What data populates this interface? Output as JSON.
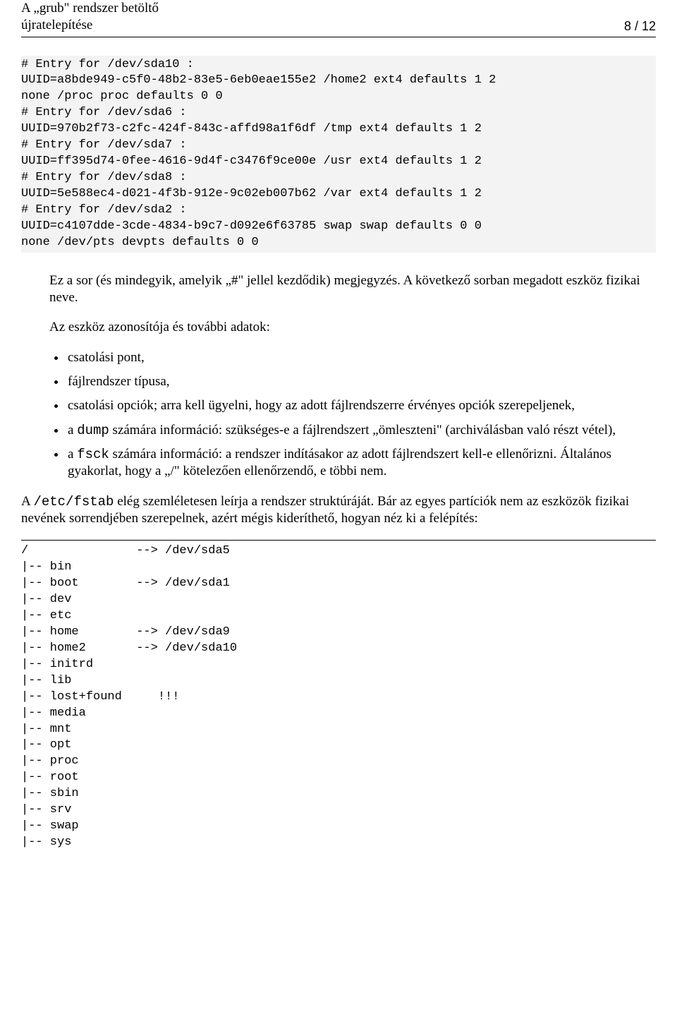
{
  "header": {
    "title_line1": "A „grub\" rendszer betöltő",
    "title_line2": "újratelepítése",
    "page_indicator": "8 / 12"
  },
  "code1": "# Entry for /dev/sda10 :\nUUID=a8bde949-c5f0-48b2-83e5-6eb0eae155e2 /home2 ext4 defaults 1 2\nnone /proc proc defaults 0 0\n# Entry for /dev/sda6 :\nUUID=970b2f73-c2fc-424f-843c-affd98a1f6df /tmp ext4 defaults 1 2\n# Entry for /dev/sda7 :\nUUID=ff395d74-0fee-4616-9d4f-c3476f9ce00e /usr ext4 defaults 1 2\n# Entry for /dev/sda8 :\nUUID=5e588ec4-d021-4f3b-912e-9c02eb007b62 /var ext4 defaults 1 2\n# Entry for /dev/sda2 :\nUUID=c4107dde-3cde-4834-b9c7-d092e6f63785 swap swap defaults 0 0\nnone /dev/pts devpts defaults 0 0",
  "para1": "Ez a sor (és mindegyik, amelyik „#\" jellel kezdődik) megjegyzés. A következő sorban megadott eszköz fizikai neve.",
  "para2": "Az eszköz azonosítója és további adatok:",
  "bullets": {
    "b1": "csatolási pont,",
    "b2": "fájlrendszer típusa,",
    "b3": "csatolási opciók; arra kell ügyelni, hogy az adott fájlrendszerre érvényes opciók szerepeljenek,",
    "b4_pre": "a ",
    "b4_code": "dump",
    "b4_post": " számára információ: szükséges-e a fájlrendszert „ömleszteni\" (archiválásban való részt vétel),",
    "b5_pre": "a ",
    "b5_code": "fsck",
    "b5_post": " számára információ: a rendszer indításakor az adott fájlrendszert kell-e ellenőrizni. Általános gyakorlat, hogy a „/\" kötelezően ellenőrzendő, e többi nem."
  },
  "para3_pre": "A ",
  "para3_code": "/etc/fstab",
  "para3_post": " elég szemléletesen leírja a rendszer struktúráját. Bár az egyes partíciók nem az eszközök fizikai nevének sorrendjében szerepelnek, azért mégis kideríthető, hogyan néz ki a felépítés:",
  "tree": "/               --> /dev/sda5\n|-- bin\n|-- boot        --> /dev/sda1\n|-- dev\n|-- etc\n|-- home        --> /dev/sda9\n|-- home2       --> /dev/sda10\n|-- initrd\n|-- lib\n|-- lost+found     !!!\n|-- media\n|-- mnt\n|-- opt\n|-- proc\n|-- root\n|-- sbin\n|-- srv\n|-- swap\n|-- sys"
}
